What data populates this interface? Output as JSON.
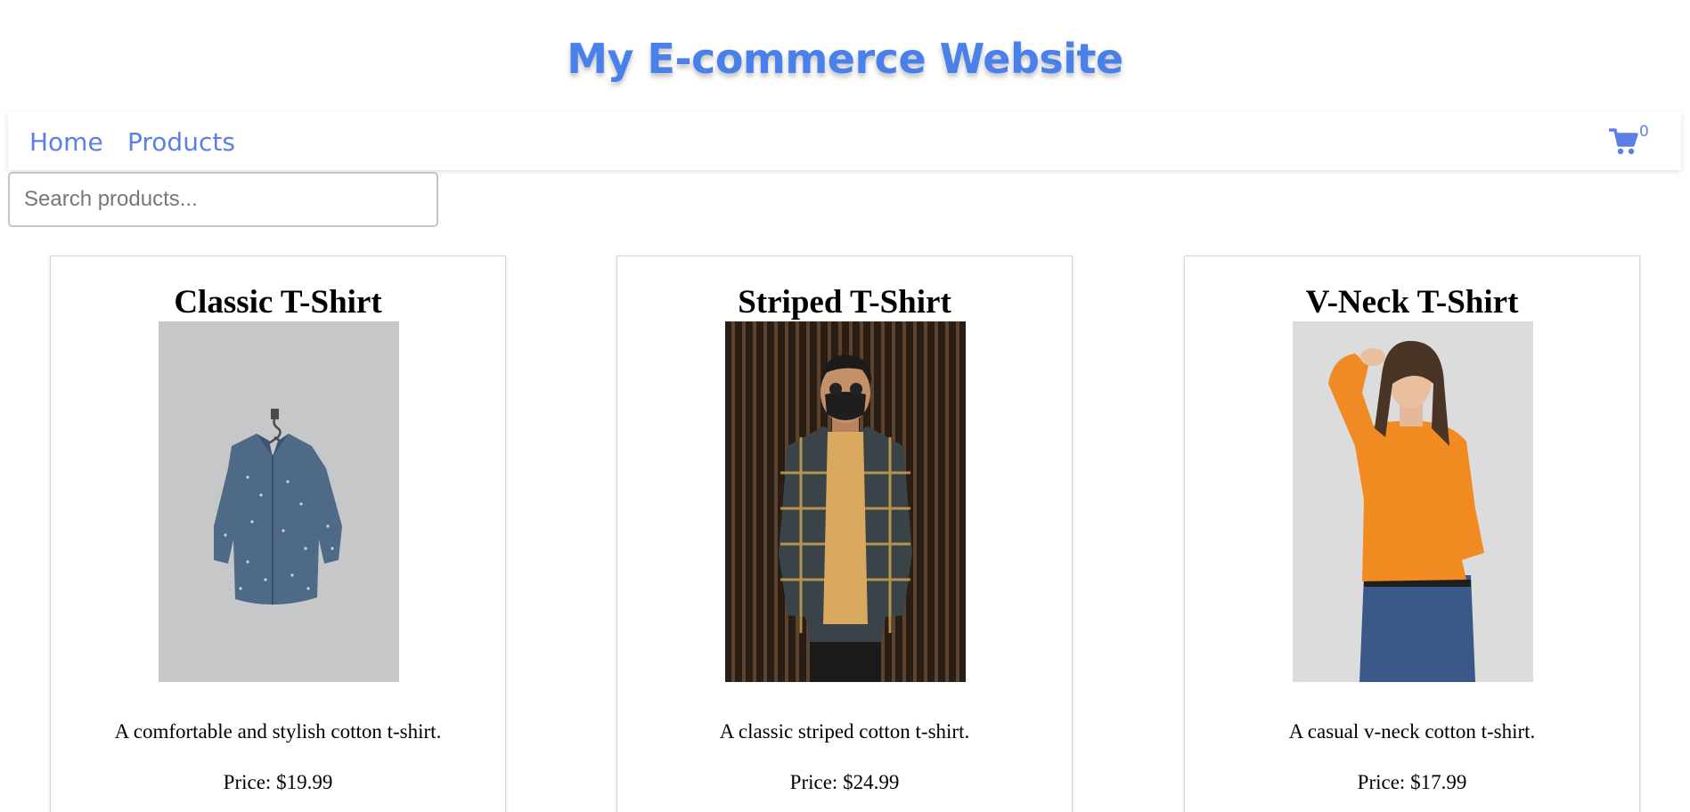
{
  "header": {
    "title": "My E-commerce Website",
    "brand_color": "#4a80ea"
  },
  "nav": {
    "links": [
      {
        "label": "Home"
      },
      {
        "label": "Products"
      }
    ],
    "cart": {
      "icon": "shopping-cart-icon",
      "count": "0"
    }
  },
  "search": {
    "placeholder": "Search products...",
    "value": ""
  },
  "products": [
    {
      "title": "Classic T-Shirt",
      "image": "denim-shirt-on-hanger",
      "description": "A comfortable and stylish cotton t-shirt.",
      "price": "Price: $19.99"
    },
    {
      "title": "Striped T-Shirt",
      "image": "man-in-plaid-shirt-and-mask",
      "description": "A classic striped cotton t-shirt.",
      "price": "Price: $24.99"
    },
    {
      "title": "V-Neck T-Shirt",
      "image": "woman-in-orange-sweatshirt",
      "description": "A casual v-neck cotton t-shirt.",
      "price": "Price: $17.99"
    }
  ]
}
